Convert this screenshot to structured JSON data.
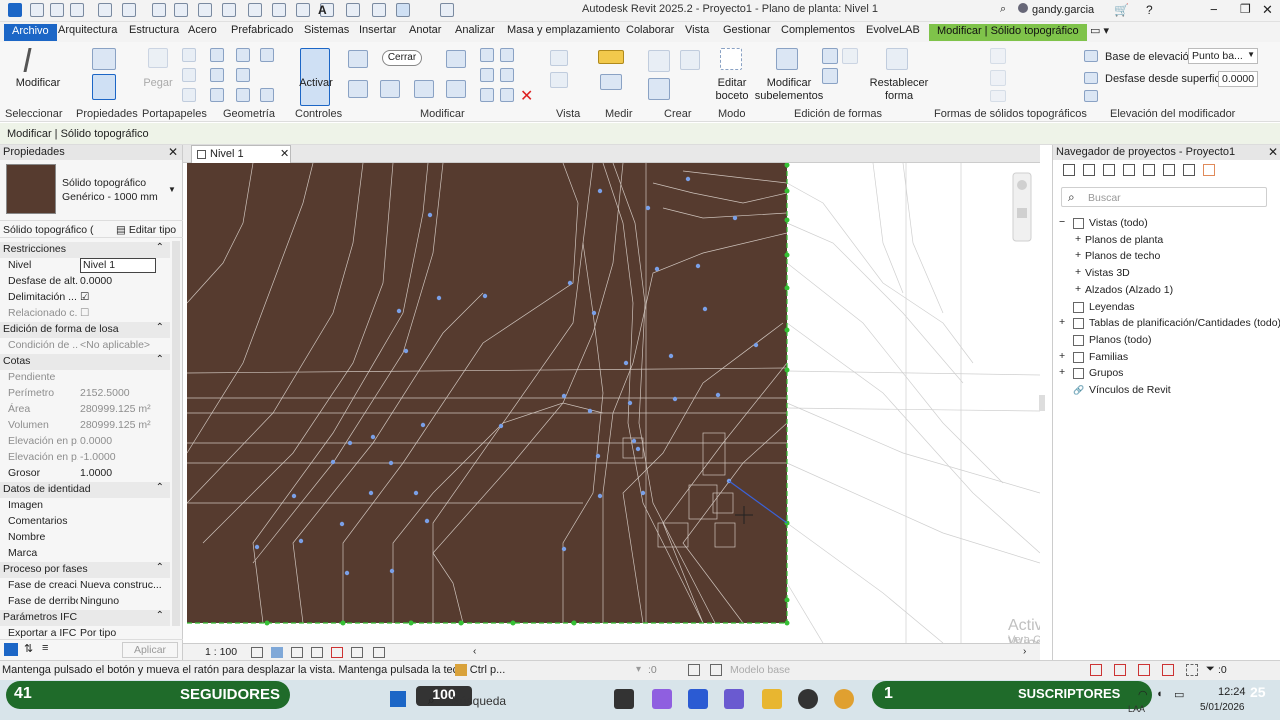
{
  "window": {
    "title": "Autodesk Revit 2025.2 - Proyecto1 - Plano de planta: Nivel 1",
    "user": "gandy.garcia"
  },
  "tabs": [
    "Archivo",
    "Arquitectura",
    "Estructura",
    "Acero",
    "Prefabricado",
    "Sistemas",
    "Insertar",
    "Anotar",
    "Analizar",
    "Masa y emplazamiento",
    "Colaborar",
    "Vista",
    "Gestionar",
    "Complementos",
    "EvolveLAB",
    "Modificar | Sólido topográfico"
  ],
  "ribbon": {
    "modify_label": "Modificar",
    "paste_label": "Pegar",
    "activate_label": "Activar",
    "close_label": "Cerrar",
    "edit_sketch": "Editar boceto",
    "modify_subelements": "Modificar subelementos",
    "reset_shape": "Restablecer forma",
    "base_elevation_label": "Base de elevación:",
    "base_elevation_value": "Punto ba...",
    "surface_offset_label": "Desfase desde superficie:",
    "surface_offset_value": "0.0000",
    "panels": [
      "Seleccionar",
      "Propiedades",
      "Portapapeles",
      "Geometría",
      "Controles",
      "Modificar",
      "Vista",
      "Medir",
      "Crear",
      "Modo",
      "Edición de formas",
      "Formas de sólidos topográficos",
      "Elevación del modificador"
    ]
  },
  "context_bar": "Modificar | Sólido topográfico",
  "properties": {
    "header": "Propiedades",
    "type_name": "Sólido topográfico",
    "type_sub": "Genérico - 1000 mm",
    "selector": "Sólido topográfico (",
    "edit_type": "Editar tipo",
    "rows": [
      {
        "kind": "section",
        "label": "Restricciones"
      },
      {
        "kind": "row",
        "k": "Nivel",
        "v": "Nivel 1",
        "style": "input"
      },
      {
        "kind": "row",
        "k": "Desfase de alt...",
        "v": "0.0000"
      },
      {
        "kind": "row",
        "k": "Delimitación ...",
        "v": "☑"
      },
      {
        "kind": "row",
        "k": "Relacionado c...",
        "v": "☐",
        "dim": true
      },
      {
        "kind": "section",
        "label": "Edición de forma de losa"
      },
      {
        "kind": "row",
        "k": "Condición de ...",
        "v": "<No aplicable>",
        "dim": true
      },
      {
        "kind": "section",
        "label": "Cotas"
      },
      {
        "kind": "row",
        "k": "Pendiente",
        "v": "",
        "dim": true
      },
      {
        "kind": "row",
        "k": "Perímetro",
        "v": "2152.5000",
        "dim": true
      },
      {
        "kind": "row",
        "k": "Área",
        "v": "280999.125 m²",
        "dim": true
      },
      {
        "kind": "row",
        "k": "Volumen",
        "v": "280999.125 m²",
        "dim": true
      },
      {
        "kind": "row",
        "k": "Elevación en p...",
        "v": "0.0000",
        "dim": true
      },
      {
        "kind": "row",
        "k": "Elevación en p...",
        "v": "-1.0000",
        "dim": true
      },
      {
        "kind": "row",
        "k": "Grosor",
        "v": "1.0000"
      },
      {
        "kind": "section",
        "label": "Datos de identidad"
      },
      {
        "kind": "row",
        "k": "Imagen",
        "v": ""
      },
      {
        "kind": "row",
        "k": "Comentarios",
        "v": ""
      },
      {
        "kind": "row",
        "k": "Nombre",
        "v": ""
      },
      {
        "kind": "row",
        "k": "Marca",
        "v": ""
      },
      {
        "kind": "section",
        "label": "Proceso por fases"
      },
      {
        "kind": "row",
        "k": "Fase de creaci...",
        "v": "Nueva construc..."
      },
      {
        "kind": "row",
        "k": "Fase de derribo",
        "v": "Ninguno"
      },
      {
        "kind": "section",
        "label": "Parámetros IFC"
      },
      {
        "kind": "row",
        "k": "Exportar a IFC",
        "v": "Por tipo"
      }
    ],
    "apply": "Aplicar"
  },
  "view_tab": "Nivel 1",
  "view_scale": "1 : 100",
  "navigator": {
    "header": "Navegador de proyectos - Proyecto1",
    "search_placeholder": "Buscar",
    "items": [
      {
        "label": "Vistas (todo)",
        "indent": 0,
        "sign": "−"
      },
      {
        "label": "Planos de planta",
        "indent": 1,
        "sign": "+"
      },
      {
        "label": "Planos de techo",
        "indent": 1,
        "sign": "+"
      },
      {
        "label": "Vistas 3D",
        "indent": 1,
        "sign": "+"
      },
      {
        "label": "Alzados (Alzado 1)",
        "indent": 1,
        "sign": "+"
      },
      {
        "label": "Leyendas",
        "indent": 0,
        "sign": ""
      },
      {
        "label": "Tablas de planificación/Cantidades (todo)",
        "indent": 0,
        "sign": "+"
      },
      {
        "label": "Planos (todo)",
        "indent": 0,
        "sign": ""
      },
      {
        "label": "Familias",
        "indent": 0,
        "sign": "+"
      },
      {
        "label": "Grupos",
        "indent": 0,
        "sign": "+"
      },
      {
        "label": "Vínculos de Revit",
        "indent": 0,
        "sign": ""
      }
    ]
  },
  "watermark": {
    "line1": "Activar Windows",
    "line2": "Ve a Configuración para activar Windows."
  },
  "status": {
    "text": "Mantenga pulsado el botón y mueva el ratón para desplazar la vista. Mantenga pulsada la tecla Ctrl p...",
    "count": ":0",
    "model": "Modelo base",
    "filter_count": ":0"
  },
  "taskbar": {
    "followers_count": "41",
    "followers_label": "SEGUIDORES",
    "hundred": "100",
    "search": "Búsqueda",
    "subs_count": "1",
    "subs_label": "SUSCRIPTORES",
    "lang": "LAA",
    "time": "12:24",
    "date": "5/01/2026",
    "side_num": "25"
  },
  "colors": {
    "accent_blue": "#1c66c6",
    "context_green": "#7fc34a",
    "topo_brown": "#563b2f",
    "pill_green": "#1f6b2a"
  }
}
